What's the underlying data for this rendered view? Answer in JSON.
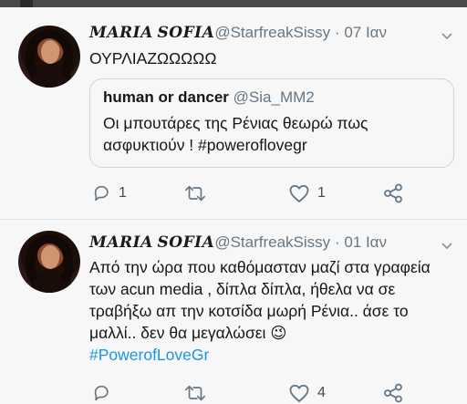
{
  "tweets": [
    {
      "name": "𝑴𝑨𝑹𝑰𝑨 𝑺𝑶𝑭𝑰𝑨",
      "handle": "@StarfreakSissy",
      "sep": "·",
      "date": "07 Ιαν",
      "text": "ΟΥΡΛΙΑΖΩΩΩΩΩ",
      "quote": {
        "name": "human or dancer",
        "handle": "@Sia_MM2",
        "text": "Οι μπουτάρες της Ρένιας θεωρώ πως ασφυκτιούν ! #poweroflovegr"
      },
      "reply_count": "1",
      "retweet_count": "",
      "like_count": "1"
    },
    {
      "name": "𝑴𝑨𝑹𝑰𝑨 𝑺𝑶𝑭𝑰𝑨",
      "handle": "@StarfreakSissy",
      "sep": "·",
      "date": "01 Ιαν",
      "text": "Από την ώρα που καθόμασταν μαζί στα γραφεία των acun media , δίπλα δίπλα, ήθελα να σε τραβήξω απ την κοτσίδα μωρή Ρένια.. άσε το μαλλί.. δεν θα μεγαλώσει 😉",
      "hashtag": "#PowerofLoveGr",
      "reply_count": "",
      "retweet_count": "",
      "like_count": "4"
    }
  ],
  "icons": [
    "reply-icon",
    "retweet-icon",
    "like-icon",
    "share-icon",
    "chevron-down-icon"
  ],
  "colors": {
    "link": "#1b95e0",
    "muted": "#657786",
    "border": "#ccd6dd"
  }
}
